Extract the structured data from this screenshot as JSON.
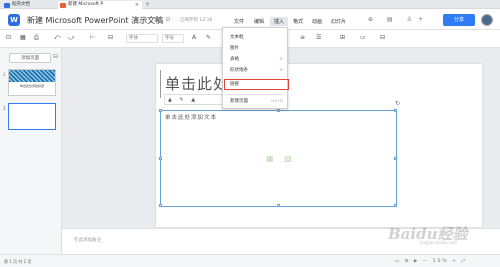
{
  "titlebar": {
    "home_tab": "稻壳文档",
    "doc_tab": "新建 Microsoft P",
    "close": "×",
    "add": "+"
  },
  "header": {
    "logo": "W",
    "doc_title": "新建 Microsoft PowerPoint 演示文稿",
    "title_icons": "☆ ⊡ ⊙",
    "saved": "已保存到 12:16",
    "menus": [
      "文件",
      "编辑",
      "插入",
      "格式",
      "动画",
      "幻灯片"
    ],
    "right_tools": "⊕ ▤ ♙+",
    "share": "分享"
  },
  "toolbar": {
    "icons": [
      "⊡",
      "▦",
      "⎙",
      "⤺",
      "⤻",
      "⊢",
      "⊟",
      "A",
      "✎",
      "≡",
      "☰",
      "⊞",
      "▭",
      "⊟"
    ],
    "font_dropdown": "字体",
    "size_dropdown": "字号"
  },
  "sidebar": {
    "new_slide": "添加页面",
    "collapse": "⊟",
    "thumbs": [
      {
        "num": "1",
        "caption": "单击此处添加标题"
      },
      {
        "num": "2",
        "caption": ""
      }
    ]
  },
  "slide": {
    "title_placeholder": "单击此处",
    "content_placeholder": "单击此处添加文本",
    "float_toolbar": "▲ ✎ ▲",
    "placeholder_icons": "▦ ▨",
    "rotate": "↻"
  },
  "insert_menu": {
    "items": [
      {
        "label": "文本框",
        "arrow": "",
        "shortcut": ""
      },
      {
        "label": "图片",
        "arrow": "",
        "shortcut": ""
      },
      {
        "label": "表格",
        "arrow": ">",
        "shortcut": ""
      },
      {
        "label": "形状线条",
        "arrow": ">",
        "shortcut": ""
      },
      {
        "label": "链接",
        "arrow": "",
        "shortcut": ""
      },
      {
        "label": "新建页面",
        "arrow": "",
        "shortcut": "Ctrl+M"
      }
    ],
    "highlighted": "链接"
  },
  "notes": {
    "placeholder": "在此添加备注"
  },
  "status": {
    "slide_count": "第 1 页 共 2 页",
    "right": "▭ ⊟ ▶ — 50% + ⤢"
  },
  "watermark": {
    "main": "Baidu经验",
    "sub": "jingyan.baidu.com"
  },
  "colors": {
    "accent": "#2f7cf6",
    "highlight_border": "#e0443a"
  }
}
